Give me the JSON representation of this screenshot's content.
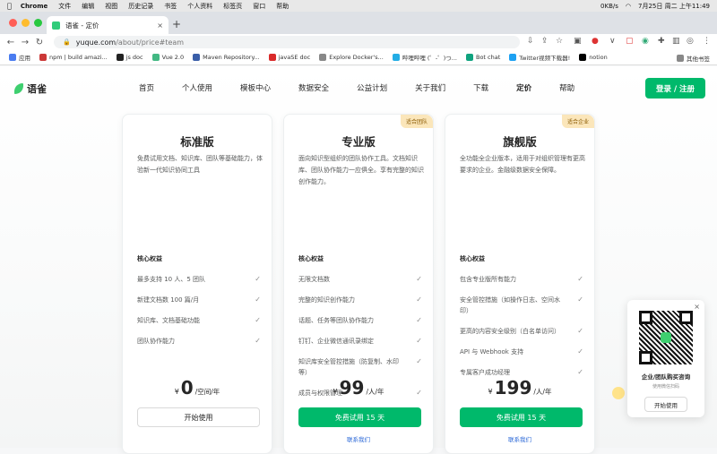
{
  "menubar": {
    "app": "Chrome",
    "items": [
      "文件",
      "编辑",
      "视图",
      "历史记录",
      "书签",
      "个人资料",
      "标签页",
      "窗口",
      "帮助"
    ],
    "datetime": "7月25日 周二 上午11:49",
    "net": "0KB/s"
  },
  "tab": {
    "title": "语雀 - 定价",
    "close": "×",
    "new": "+"
  },
  "address": {
    "host": "yuque.com",
    "path": "/about/price#team"
  },
  "bookmarks": [
    "应用",
    "npm | build amazi...",
    "js doc",
    "Vue 2.0",
    "Maven Repository...",
    "javaSE doc",
    "Explore Docker's...",
    "哔哩哔哩 (゜-゜)つ...",
    "Bot chat",
    "Twitter视频下载器!",
    "notion"
  ],
  "bookmarks_other": "其他书签",
  "site": {
    "logo": "语雀",
    "nav": [
      "首页",
      "个人使用",
      "模板中心",
      "数据安全",
      "公益计划",
      "关于我们",
      "下载",
      "定价",
      "帮助"
    ],
    "login": "登录 / 注册"
  },
  "features_title": "核心权益",
  "plans": [
    {
      "name": "标准版",
      "tag": "",
      "desc": "免费试用文档、知识库、团队等基础能力，体验新一代知识协同工具",
      "features": [
        "最多支持 10 人、5 团队",
        "新建文档数 100 篇/月",
        "知识库、文档基础功能",
        "团队协作能力"
      ],
      "currency": "¥",
      "price": "0",
      "unit": "/空间/年",
      "button": "开始使用",
      "contact": ""
    },
    {
      "name": "专业版",
      "tag": "适合团队",
      "desc": "面向知识型组织的团队协作工具。文档知识库、团队协作能力一应俱全。享有完整的知识创作能力。",
      "features": [
        "无限文档数",
        "完整的知识创作能力",
        "话题、任务等团队协作能力",
        "钉钉、企业微信通讯录绑定",
        "知识库安全管控措施（防复制、水印等）",
        "成员与权限管理"
      ],
      "currency": "¥",
      "price": "99",
      "unit": "/人/年",
      "button": "免费试用 15 天",
      "contact": "联系我们"
    },
    {
      "name": "旗舰版",
      "tag": "适合企业",
      "desc": "全功能全企业版本，适用于对组织管理有更高要求的企业。金融级数据安全保障。",
      "features": [
        "包含专业版所有能力",
        "安全管控措施（如操作日志、空间水印）",
        "更高的内容安全级别（白名单访问）",
        "API 与 Webhook 支持",
        "专属客户成功经理"
      ],
      "currency": "¥",
      "price": "199",
      "unit": "/人/年",
      "button": "免费试用 15 天",
      "contact": "联系我们"
    }
  ],
  "qr": {
    "title": "企业/团队购买咨询",
    "sub": "使用微信扫码",
    "button": "开始使用",
    "close": "×"
  }
}
